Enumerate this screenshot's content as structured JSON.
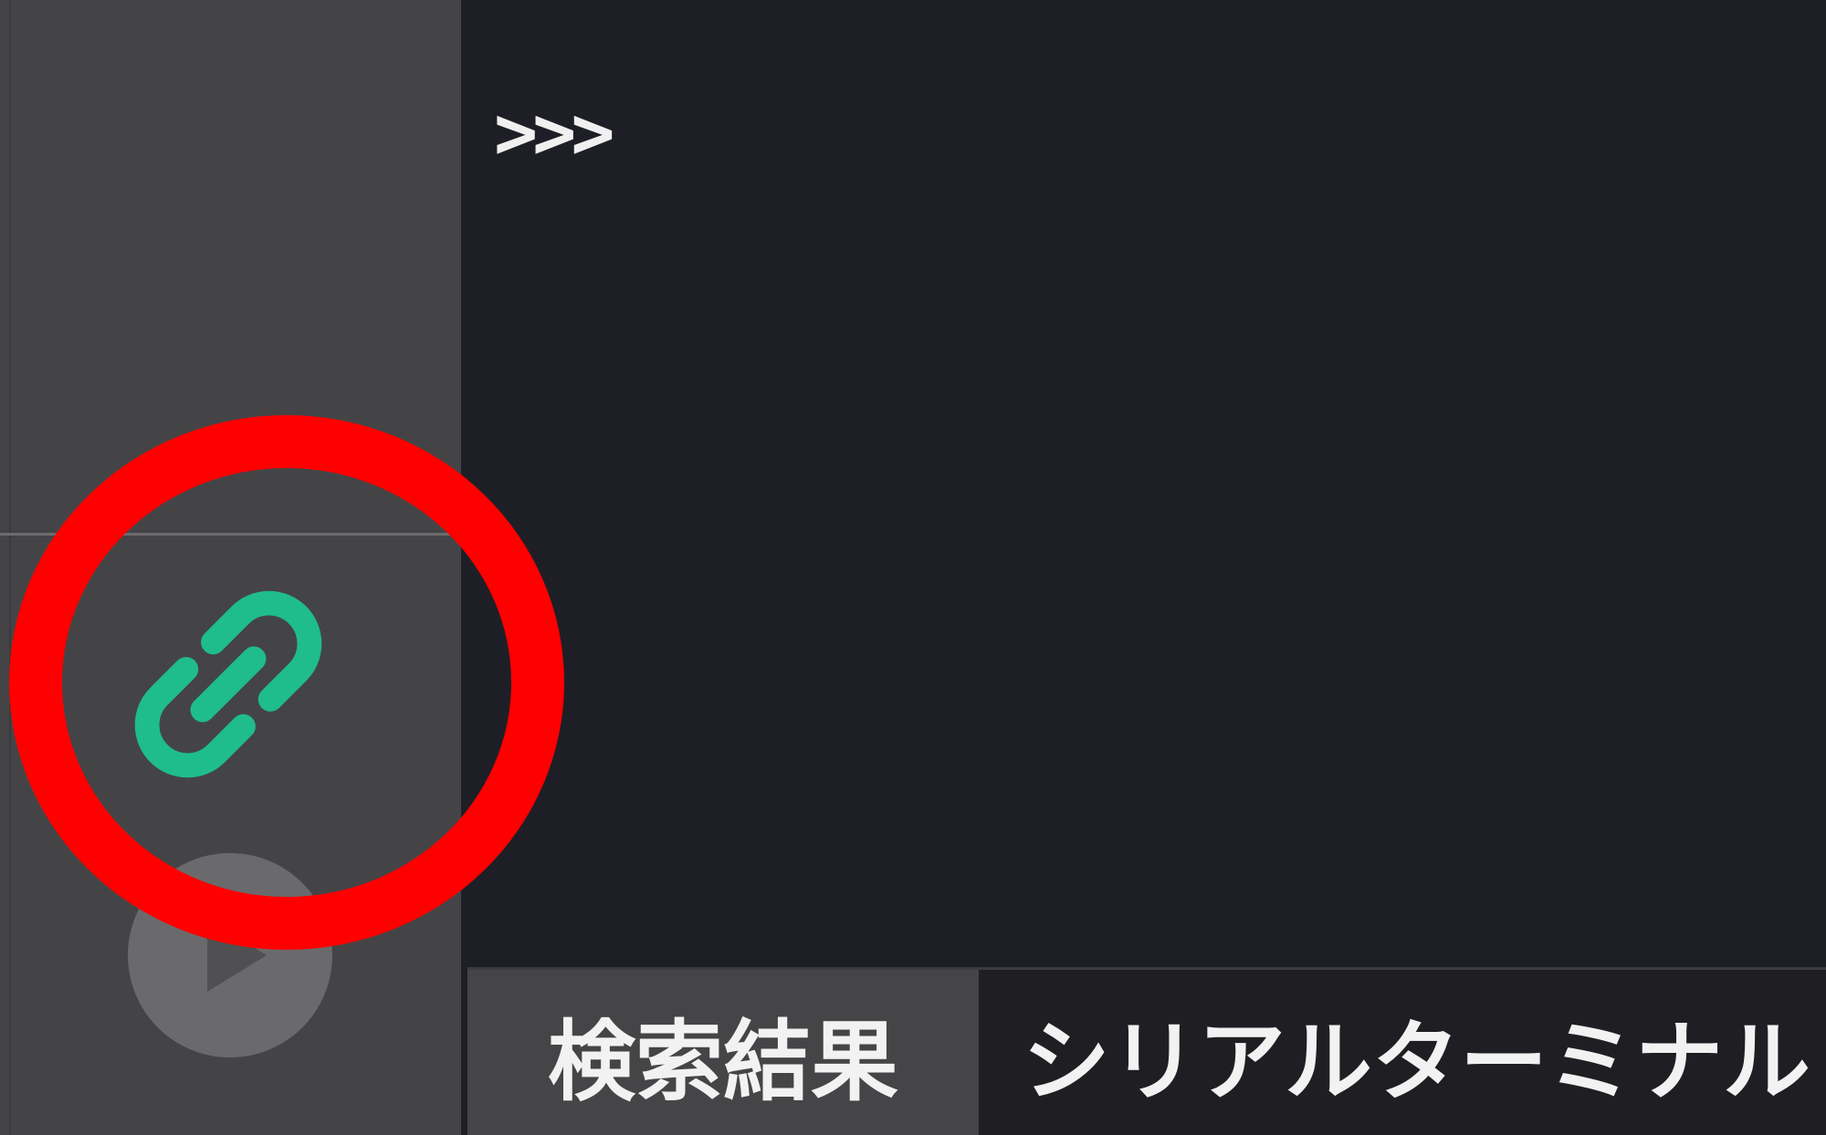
{
  "console": {
    "prompt": ">>>"
  },
  "toolbar": {
    "link_icon": "link-icon",
    "link_color": "#1fbd8a",
    "run_icon": "play-icon"
  },
  "tabs": [
    {
      "label": "検索結果"
    },
    {
      "label": "シリアルターミナル"
    }
  ],
  "annotation": {
    "color": "#ff0000"
  }
}
